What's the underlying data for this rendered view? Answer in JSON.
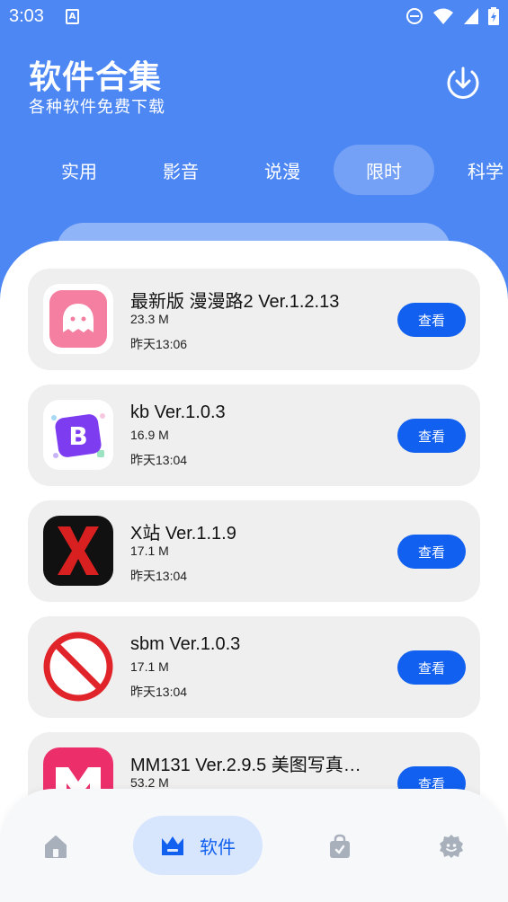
{
  "status_bar": {
    "time": "3:03",
    "notification_glyph": "A"
  },
  "header": {
    "title": "软件合集",
    "subtitle": "各种软件免费下载"
  },
  "tabs": [
    {
      "label": "实用",
      "active": false
    },
    {
      "label": "影音",
      "active": false
    },
    {
      "label": "说漫",
      "active": false
    },
    {
      "label": "限时",
      "active": true
    },
    {
      "label": "科学",
      "active": false
    }
  ],
  "apps": [
    {
      "name": "最新版 漫漫路2 Ver.1.2.13",
      "size": "23.3 M",
      "time": "昨天13:06",
      "button": "查看",
      "icon": "ghost-icon"
    },
    {
      "name": "kb Ver.1.0.3",
      "size": "16.9 M",
      "time": "昨天13:04",
      "button": "查看",
      "icon": "bootstrap-icon"
    },
    {
      "name": "X站 Ver.1.1.9",
      "size": "17.1 M",
      "time": "昨天13:04",
      "button": "查看",
      "icon": "x-icon"
    },
    {
      "name": "sbm Ver.1.0.3",
      "size": "17.1 M",
      "time": "昨天13:04",
      "button": "查看",
      "icon": "prohibited-icon"
    },
    {
      "name": "MM131 Ver.2.9.5 美图写真…",
      "size": "53.2 M",
      "time": "",
      "button": "查看",
      "icon": "m-logo-icon"
    }
  ],
  "bottom_nav": {
    "active_label": "软件",
    "items": [
      "home-icon",
      "crown-icon",
      "shop-bag-icon",
      "user-face-icon"
    ]
  },
  "colors": {
    "header_bg": "#4d87f3",
    "accent": "#1160ef",
    "card_bg": "#efefef"
  }
}
